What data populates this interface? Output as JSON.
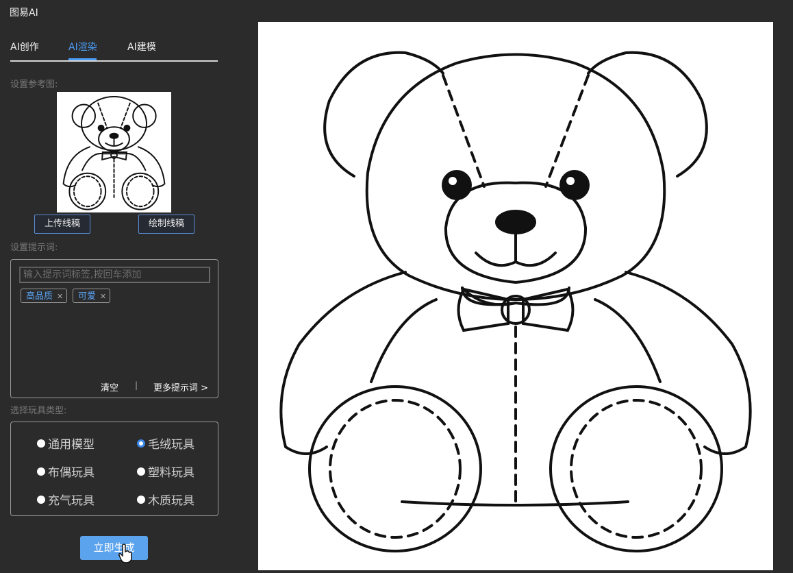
{
  "app": {
    "title": "图易AI"
  },
  "tabs": [
    {
      "label": "AI创作",
      "active": false
    },
    {
      "label": "AI渲染",
      "active": true
    },
    {
      "label": "AI建模",
      "active": false
    }
  ],
  "reference": {
    "label": "设置参考图:",
    "upload_button": "上传线稿",
    "draw_button": "绘制线稿"
  },
  "prompt": {
    "label": "设置提示词:",
    "placeholder": "输入提示词标签,按回车添加",
    "tags": [
      "高品质",
      "可爱"
    ],
    "clear_button": "清空",
    "separator": "|",
    "more_button": "更多提示词 >"
  },
  "toy_type": {
    "label": "选择玩具类型:",
    "options": [
      "通用模型",
      "毛绒玩具",
      "布偶玩具",
      "塑料玩具",
      "充气玩具",
      "木质玩具"
    ],
    "selected": "毛绒玩具"
  },
  "generate_button": "立即生成",
  "colors": {
    "accent": "#4a9cf5",
    "background": "#2b2b2b",
    "button": "#5ca3ee"
  }
}
